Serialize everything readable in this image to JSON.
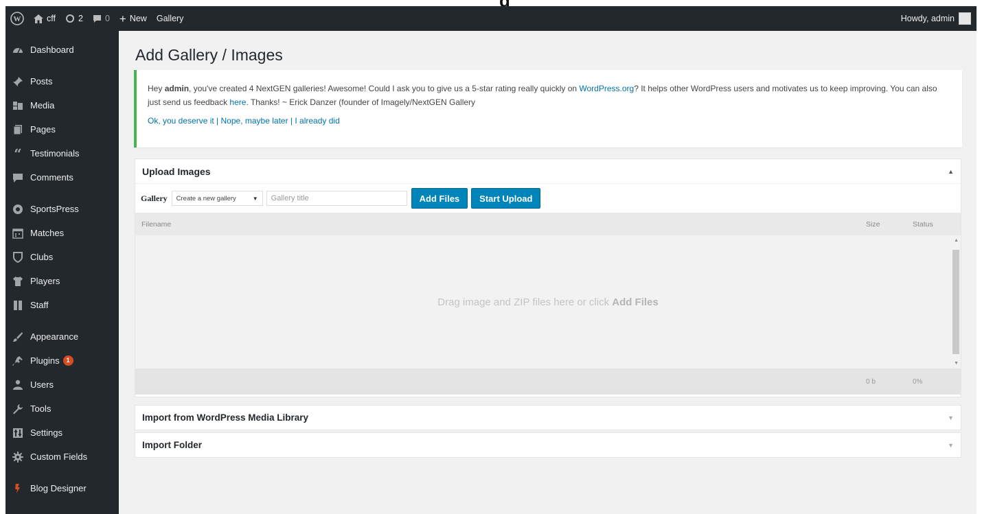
{
  "adminbar": {
    "site_name": "cff",
    "updates_count": "2",
    "comments_count": "0",
    "new_label": "New",
    "gallery_label": "Gallery",
    "howdy": "Howdy, admin"
  },
  "sidebar": {
    "items": [
      {
        "label": "Dashboard",
        "icon": "dashboard-icon"
      },
      {
        "label": "Posts",
        "icon": "pushpin-icon"
      },
      {
        "label": "Media",
        "icon": "media-icon"
      },
      {
        "label": "Pages",
        "icon": "pages-icon"
      },
      {
        "label": "Testimonials",
        "icon": "quote-icon"
      },
      {
        "label": "Comments",
        "icon": "comment-icon"
      },
      {
        "label": "SportsPress",
        "icon": "sportspress-icon"
      },
      {
        "label": "Matches",
        "icon": "calendar-icon"
      },
      {
        "label": "Clubs",
        "icon": "shield-icon"
      },
      {
        "label": "Players",
        "icon": "shirt-icon"
      },
      {
        "label": "Staff",
        "icon": "id-card-icon"
      },
      {
        "label": "Appearance",
        "icon": "brush-icon"
      },
      {
        "label": "Plugins",
        "icon": "plug-icon",
        "badge": "1"
      },
      {
        "label": "Users",
        "icon": "users-icon"
      },
      {
        "label": "Tools",
        "icon": "wrench-icon"
      },
      {
        "label": "Settings",
        "icon": "settings-icon"
      },
      {
        "label": "Custom Fields",
        "icon": "gear-icon"
      },
      {
        "label": "Blog Designer",
        "icon": "blog-designer-icon"
      }
    ]
  },
  "page": {
    "title": "Add Gallery / Images"
  },
  "notice": {
    "part1": "Hey ",
    "user": "admin",
    "part2": ", you've created 4 NextGEN galleries! Awesome! Could I ask you to give us a 5-star rating really quickly on ",
    "wp_link": "WordPress.org",
    "part3": "? It helps other WordPress users and motivates us to keep improving. You can also just send us feedback ",
    "here_link": "here",
    "part4": ". Thanks! ~ Erick Danzer (founder of Imagely/NextGEN Gallery",
    "link_yes": "Ok, you deserve it",
    "link_later": "Nope, maybe later",
    "link_did": "I already did",
    "separator": " | "
  },
  "upload": {
    "heading": "Upload Images",
    "gallery_label": "Gallery",
    "select_value": "Create a new gallery",
    "title_placeholder": "Gallery title",
    "add_files": "Add Files",
    "start_upload": "Start Upload",
    "col_filename": "Filename",
    "col_size": "Size",
    "col_status": "Status",
    "drop_text": "Drag image and ZIP files here or click ",
    "drop_bold": "Add Files",
    "total_size": "0 b",
    "total_percent": "0%"
  },
  "import_media": {
    "heading": "Import from WordPress Media Library"
  },
  "import_folder": {
    "heading": "Import Folder"
  }
}
